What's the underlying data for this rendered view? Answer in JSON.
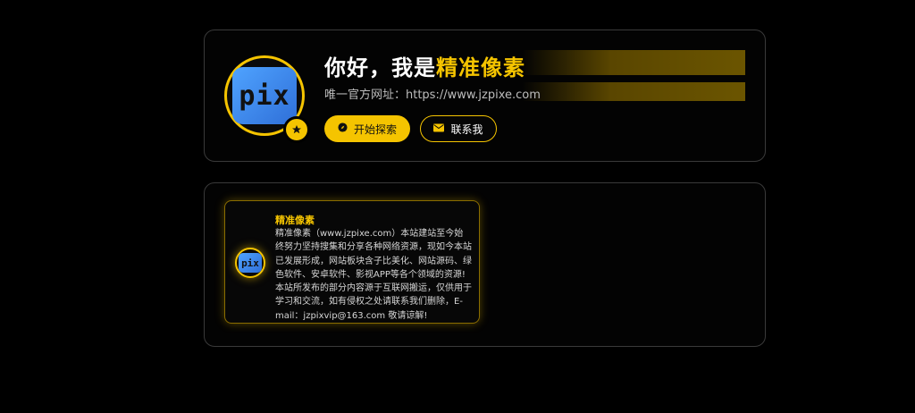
{
  "hero": {
    "title_prefix": "你好，我是",
    "title_highlight": "精准像素",
    "subtitle": "唯一官方网址：https://www.jzpixe.com",
    "logo_text": "pix",
    "avatar_badge_icon": "star-icon",
    "buttons": {
      "explore_label": "开始探索",
      "explore_icon": "compass-icon",
      "contact_label": "联系我",
      "contact_icon": "envelope-icon"
    }
  },
  "about": {
    "logo_text": "pix",
    "title": "精准像素",
    "description": "精准像素（www.jzpixe.com）本站建站至今始终努力坚持搜集和分享各种网络资源，现如今本站已发展形成，网站板块含子比美化、网站源码、绿色软件、安卓软件、影视APP等各个领域的资源!本站所发布的部分内容源于互联网搬运，仅供用于学习和交流，如有侵权之处请联系我们删除，E-mail：jzpixvip@163.com 敬请谅解!"
  },
  "colors": {
    "accent": "#f5c400",
    "background": "#000000",
    "logo_blue": "#3d86ea"
  }
}
